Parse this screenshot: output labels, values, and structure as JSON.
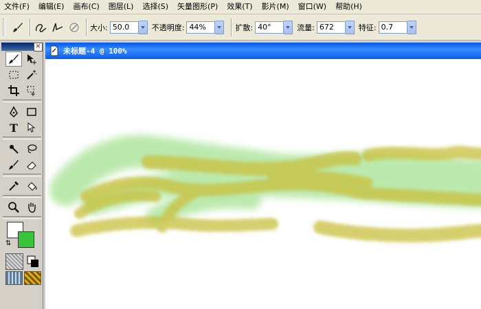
{
  "menu": [
    "文件(F)",
    "编辑(E)",
    "画布(C)",
    "图层(L)",
    "选择(S)",
    "矢量图形(P)",
    "效果(T)",
    "影片(M)",
    "窗口(W)",
    "帮助(H)"
  ],
  "toolbar": {
    "size_label": "大小:",
    "size_value": "50.0",
    "opacity_label": "不透明度:",
    "opacity_value": "44%",
    "spread_label": "扩散:",
    "spread_value": "40°",
    "flow_label": "流量:",
    "flow_value": "672",
    "feature_label": "特征:",
    "feature_value": "0.7"
  },
  "document": {
    "title": "未标题-4 @ 100%"
  },
  "colors": {
    "stroke_color": "#ffffff",
    "fill_color": "#3cc33c",
    "brush_yellow": "#c9c03c",
    "brush_green": "#6ccf4c"
  },
  "icons": [
    "paint-brush-icon",
    "freehand-icon",
    "line-icon",
    "brush-preset-icon"
  ]
}
